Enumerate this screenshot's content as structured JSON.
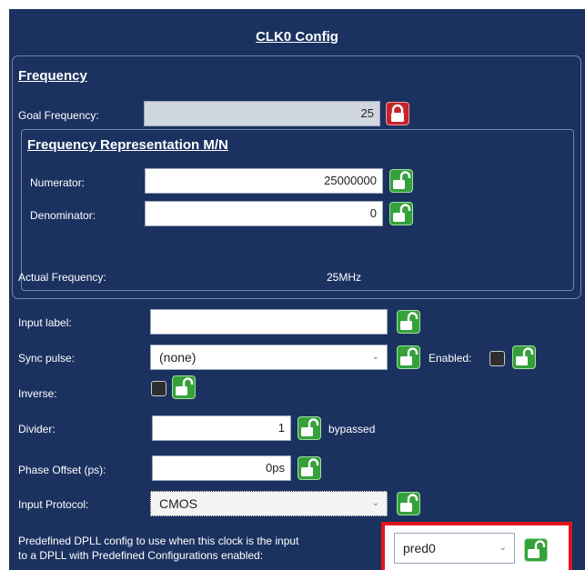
{
  "window": {
    "title": "CLK0 Config"
  },
  "frequency": {
    "heading": "Frequency",
    "goal_label": "Goal Frequency:",
    "goal_value": "25",
    "goal_lock": "locked",
    "mn": {
      "heading": "Frequency Representation M/N",
      "numerator_label": "Numerator:",
      "numerator_value": "25000000",
      "denominator_label": "Denominator:",
      "denominator_value": "0"
    },
    "actual_label": "Actual Frequency:",
    "actual_value": "25MHz"
  },
  "settings": {
    "input_label_label": "Input label:",
    "input_label_value": "",
    "sync_pulse_label": "Sync pulse:",
    "sync_pulse_value": "(none)",
    "enabled_label": "Enabled:",
    "inverse_label": "Inverse:",
    "divider_label": "Divider:",
    "divider_value": "1",
    "bypassed_label": "bypassed",
    "phase_label": "Phase Offset (ps):",
    "phase_value": "0ps",
    "protocol_label": "Input Protocol:",
    "protocol_value": "CMOS",
    "predefined_line1": "Predefined DPLL config to use when this clock is the input",
    "predefined_line2": "to a DPLL with Predefined Configurations enabled:",
    "predefined_value": "pred0"
  },
  "colors": {
    "panel": "#1b3260",
    "unlock": "#35a13b",
    "lock": "#c4242c",
    "highlight": "#e3141b"
  },
  "icons": {
    "lock": "lock-icon",
    "unlock": "unlock-icon",
    "dropdown": "chevron-down-icon"
  }
}
